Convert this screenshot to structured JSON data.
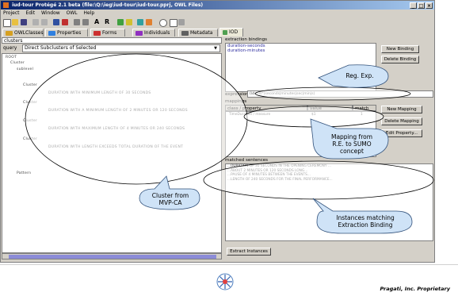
{
  "window": {
    "title": "iud-tour Protégé 2.1 beta   (file:\\Q:\\ieg\\iud-tour\\iud-tour.pprj, OWL Files)",
    "controls": [
      "_",
      "□",
      "×"
    ]
  },
  "menu": [
    "Project",
    "Edit",
    "Window",
    "OWL",
    "Help"
  ],
  "toolbar": {
    "icons": [
      "new-icon",
      "open-icon",
      "save-icon",
      "undo-icon",
      "redo-icon",
      "cut-icon",
      "copy-icon",
      "paste-icon",
      "a-icon",
      "r-icon",
      "class-icon",
      "slot-icon",
      "instance-icon",
      "query-icon",
      "help-icon",
      "table-icon",
      "export-icon"
    ],
    "letters": {
      "a": "A",
      "r": "R"
    }
  },
  "tabs": [
    {
      "label": "OWLClasses",
      "color": "#d6a020"
    },
    {
      "label": "Properties",
      "color": "#3080e0"
    },
    {
      "label": "Forms",
      "color": "#cc3030"
    },
    {
      "label": "Individuals",
      "color": "#9030c0"
    },
    {
      "label": "Metadata",
      "color": "#606060"
    },
    {
      "label": "IOD",
      "color": "#50a050"
    }
  ],
  "left_panel": {
    "header": "clusters",
    "query_label": "query",
    "query_value": "Direct Subclusters of Selected",
    "tree": [
      "ROOT",
      "Cluster",
      "sublevel",
      "Cluster",
      "DURATION WITH MINIMUM LENGTH OF 30 SECONDS",
      "Cluster",
      "DURATION WITH A MINIMUM LENGTH OF 2 MINUTES OR 120 SECONDS",
      "Cluster",
      "DURATION WITH MAXIMUM LENGTH OF 4 MINUTES OR 240 SECONDS",
      "Cluster",
      "DURATION WITH LENGTH EXCEEDS TOTAL DURATION OF THE EVENT",
      "Pattern"
    ]
  },
  "right_panel": {
    "extraction_label": "extraction bindings",
    "bindings": [
      "duration-seconds",
      "duration-minutes"
    ],
    "new_binding": "New Binding",
    "delete_binding": "Delete Binding",
    "expression_label": "expression",
    "expression_value": "(\\d+)\\s*(seconds|minutes|sec|min|s)",
    "mappings_label": "mappings",
    "col_class": "class / property",
    "col_value": "value",
    "col_match": "match",
    "mapping_rows": [
      [
        "TimeDuration / measure",
        "$1",
        "1"
      ]
    ],
    "new_mapping": "New Mapping",
    "delete_mapping": "Delete Mapping",
    "edit_property": "Edit Property...",
    "matched_label": "matched sentences",
    "sentences": [
      "...DURATION OF 30 SECONDS IN THE OPENING CEREMONY ...",
      "...ABOUT 2 MINUTES OR 120 SECONDS LONG...",
      "...PAUSE OF 4 MINUTES BETWEEN THE EVENTS...",
      "...LENGTH OF 240 SECONDS FOR THE FINAL PERFORMANCE..."
    ],
    "extract_button": "Extract Instances"
  },
  "callouts": {
    "regexp": "Reg. Exp.",
    "mapping_l1": "Mapping  from",
    "mapping_l2": "R.E. to SUMO",
    "mapping_l3": "concept",
    "cluster_l1": "Cluster from",
    "cluster_l2": "MVP-CA",
    "instances_l1": "Instances matching",
    "instances_l2": "Extraction Binding"
  },
  "footer": {
    "proprietary": "Pragati, Inc. Proprietary"
  }
}
